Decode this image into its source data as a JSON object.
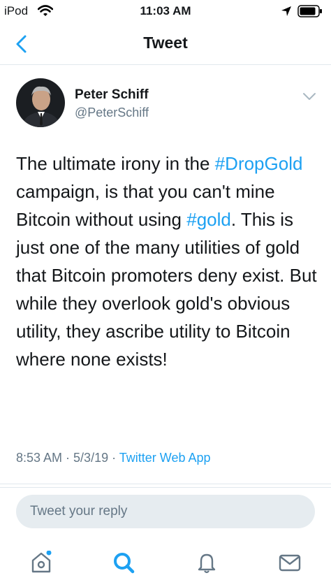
{
  "status": {
    "carrier": "iPod",
    "time": "11:03 AM"
  },
  "nav": {
    "title": "Tweet"
  },
  "author": {
    "name": "Peter Schiff",
    "handle": "@PeterSchiff"
  },
  "tweet": {
    "t1": "The ultimate irony in the ",
    "tag1": "#DropGold",
    "t2": " campaign, is that you can't mine Bitcoin without using ",
    "tag2": "#gold",
    "t3": ". This is just one of the many utilities of gold that Bitcoin promoters deny exist.  But while they overlook gold's obvious utility, they ascribe utility to Bitcoin where none exists!"
  },
  "meta": {
    "time": "8:53 AM",
    "sep1": " · ",
    "date": "5/3/19",
    "sep2": " · ",
    "app": "Twitter Web App"
  },
  "reply": {
    "placeholder": "Tweet your reply"
  },
  "tabs": [
    {
      "icon": "home-icon",
      "active": false
    },
    {
      "icon": "search-icon",
      "active": true
    },
    {
      "icon": "notifications-icon",
      "active": false
    },
    {
      "icon": "messages-icon",
      "active": false
    }
  ],
  "colors": {
    "accent": "#1da1f2",
    "muted": "#657786",
    "text": "#14171a"
  }
}
